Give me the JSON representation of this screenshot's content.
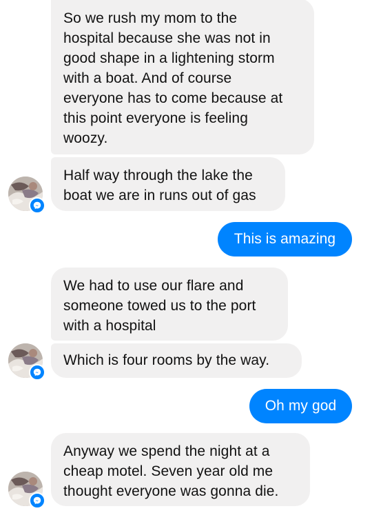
{
  "messages": [
    {
      "id": "m1",
      "direction": "incoming",
      "lines": [
        "So we rush my mom to the",
        "hospital because she was not in",
        "good shape in a lightening storm",
        "with a boat. And of course",
        "everyone has to come because at",
        "this point everyone is feeling",
        "woozy."
      ]
    },
    {
      "id": "m2",
      "direction": "incoming",
      "lines": [
        "Half way through the lake the",
        "boat we are in runs out of gas"
      ]
    },
    {
      "id": "m3",
      "direction": "outgoing",
      "text": "This is amazing"
    },
    {
      "id": "m4",
      "direction": "incoming",
      "lines": [
        "We had to use our flare and",
        "someone towed us to the port",
        "with a hospital"
      ]
    },
    {
      "id": "m5",
      "direction": "incoming",
      "lines": [
        "Which is four rooms by the way."
      ]
    },
    {
      "id": "m6",
      "direction": "outgoing",
      "text": "Oh my god"
    },
    {
      "id": "m7",
      "direction": "incoming",
      "lines": [
        "Anyway we spend the night at a",
        "cheap motel. Seven year old me",
        "thought everyone was gonna die."
      ]
    }
  ],
  "avatar": {
    "icon": "contact-photo",
    "badge_icon": "messenger-icon"
  },
  "colors": {
    "incoming_bg": "#f1f0f0",
    "outgoing_bg": "#0084ff",
    "incoming_text": "#111111",
    "outgoing_text": "#ffffff"
  }
}
